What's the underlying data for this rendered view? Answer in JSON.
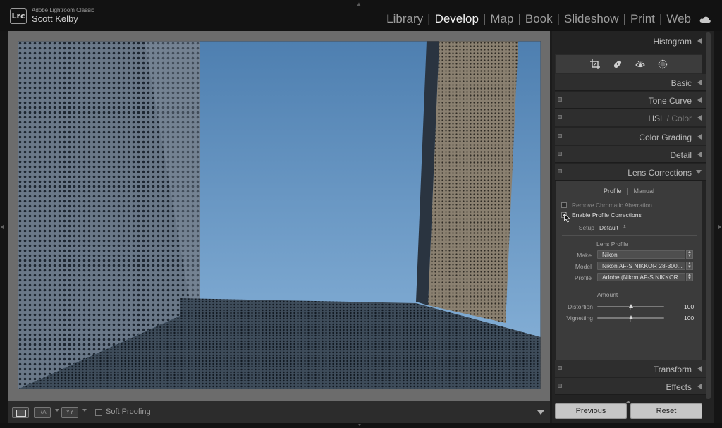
{
  "header": {
    "logo_text": "Lrc",
    "app_name": "Adobe Lightroom Classic",
    "user_name": "Scott Kelby",
    "modules": [
      "Library",
      "Develop",
      "Map",
      "Book",
      "Slideshow",
      "Print",
      "Web"
    ],
    "active_module": "Develop"
  },
  "toolbar": {
    "view_mode_loupe": "loupe-view-icon",
    "before_after_ra": "RA",
    "before_after_yy": "YY",
    "soft_proofing_label": "Soft Proofing",
    "soft_proofing_checked": false
  },
  "panel": {
    "histogram": "Histogram",
    "tools": [
      "crop-icon",
      "healing-icon",
      "red-eye-icon",
      "radial-mask-icon"
    ],
    "sections": {
      "basic": "Basic",
      "tone_curve": "Tone Curve",
      "hsl": "HSL",
      "hsl_sep": " / ",
      "color": "Color",
      "color_grading": "Color Grading",
      "detail": "Detail",
      "lens_corrections": "Lens Corrections",
      "transform": "Transform",
      "effects": "Effects"
    },
    "lens": {
      "tab_profile": "Profile",
      "tab_manual": "Manual",
      "active_tab": "Profile",
      "remove_ca_label": "Remove Chromatic Aberration",
      "remove_ca_checked": false,
      "enable_profile_label": "Enable Profile Corrections",
      "enable_profile_checked": true,
      "setup_label": "Setup",
      "setup_value": "Default",
      "setup_arrow": "⇕",
      "lens_profile_heading": "Lens Profile",
      "make_label": "Make",
      "make_value": "Nikon",
      "model_label": "Model",
      "model_value": "Nikon AF-S NIKKOR 28-300...",
      "profile_label": "Profile",
      "profile_value": "Adobe (Nikon AF-S NIKKOR...",
      "amount_heading": "Amount",
      "distortion_label": "Distortion",
      "distortion_value": "100",
      "distortion_fraction": 0.5,
      "vignetting_label": "Vignetting",
      "vignetting_value": "100",
      "vignetting_fraction": 0.5
    },
    "buttons": {
      "previous": "Previous",
      "reset": "Reset"
    }
  },
  "colors": {
    "accent_text": "#f0f0f0",
    "panel_bg": "#232323",
    "button_bg": "#c6c6c6"
  }
}
